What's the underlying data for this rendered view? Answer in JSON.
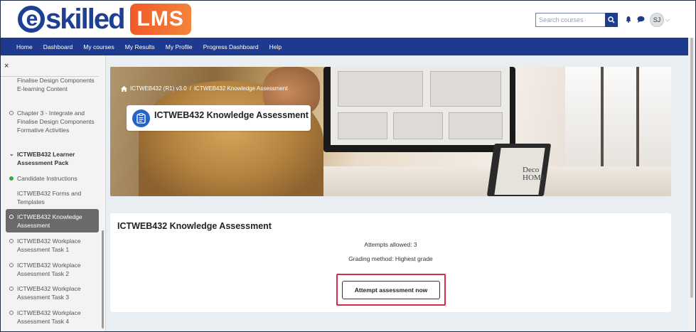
{
  "brand": {
    "logo_text": "skilled",
    "logo_initial": "e",
    "badge": "LMS",
    "primary_color": "#1d3a8f",
    "badge_color": "#f05a28"
  },
  "header": {
    "search_placeholder": "Search courses",
    "avatar_initials": "SJ"
  },
  "nav": [
    "Home",
    "Dashboard",
    "My courses",
    "My Results",
    "My Profile",
    "Progress Dashboard",
    "Help"
  ],
  "sidebar": {
    "close_label": "×",
    "items": [
      {
        "label": "Finalise Design Components E-learning Content",
        "status": "none"
      },
      {
        "label": "Chapter 3 - Integrate and Finalise Design Components Formative Activities",
        "status": "incomplete"
      },
      {
        "label": "ICTWEB432 Learner Assessment Pack",
        "status": "section-expanded"
      },
      {
        "label": "Candidate Instructions",
        "status": "complete"
      },
      {
        "label": "ICTWEB432 Forms and Templates",
        "status": "none"
      },
      {
        "label": "ICTWEB432 Knowledge Assessment",
        "status": "current"
      },
      {
        "label": "ICTWEB432 Workplace Assessment Task 1",
        "status": "incomplete"
      },
      {
        "label": "ICTWEB432 Workplace Assessment Task 2",
        "status": "incomplete"
      },
      {
        "label": "ICTWEB432 Workplace Assessment Task 3",
        "status": "incomplete"
      },
      {
        "label": "ICTWEB432 Workplace Assessment Task 4",
        "status": "incomplete"
      }
    ]
  },
  "hero": {
    "breadcrumb": [
      "ICTWEB432 (R1) v3.0",
      "ICTWEB432 Knowledge Assessment"
    ],
    "breadcrumb_sep": "/",
    "title": "ICTWEB432 Knowledge Assessment",
    "laptop_text_1": "Deco",
    "laptop_text_2": "HOME"
  },
  "content": {
    "title": "ICTWEB432 Knowledge Assessment",
    "attempts": "Attempts allowed: 3",
    "grading": "Grading method: Highest grade",
    "button": "Attempt assessment now"
  }
}
